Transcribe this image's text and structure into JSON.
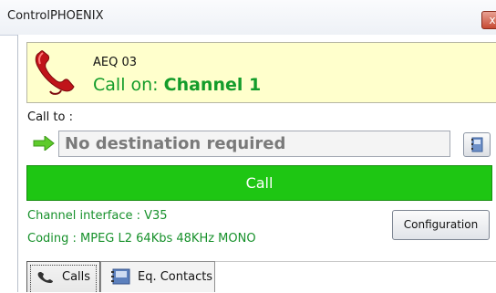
{
  "window": {
    "title": "ControlPHOENIX",
    "close_glyph": "x"
  },
  "header": {
    "device": "AEQ 03",
    "status_prefix": "Call on: ",
    "channel": "Channel 1",
    "icon": "phone-icon",
    "status_color": "#139c2a"
  },
  "call_to": {
    "label": "Call to :",
    "destination": "No destination required",
    "arrow_icon": "green-arrow-icon",
    "address_book_icon": "address-book-icon"
  },
  "call_button": {
    "label": "Call",
    "color": "#1ec613"
  },
  "info": {
    "channel_interface": "Channel interface : V35",
    "coding": "Coding : MPEG L2 64Kbs 48KHz MONO"
  },
  "config_button": {
    "label": "Configuration"
  },
  "tabs": [
    {
      "label": "Calls",
      "icon": "phone-icon",
      "selected": true
    },
    {
      "label": "Eq. Contacts",
      "icon": "contacts-icon",
      "selected": false
    }
  ]
}
